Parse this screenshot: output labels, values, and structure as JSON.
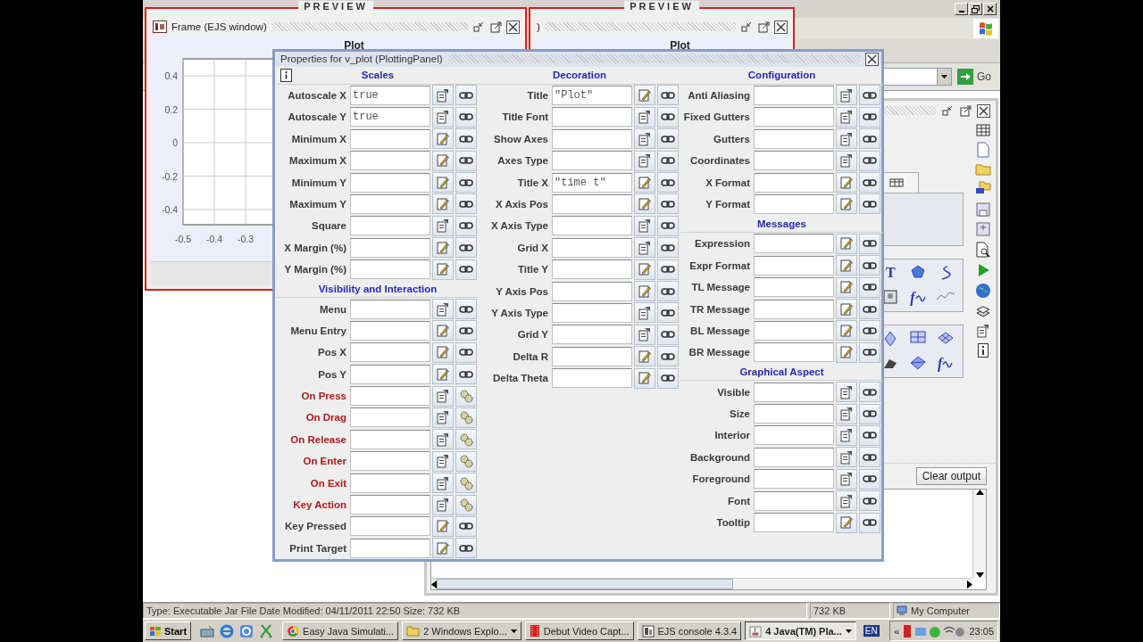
{
  "previews": [
    {
      "label": "PREVIEW",
      "window_title": "Frame (EJS window)",
      "plot_title": "Plot",
      "y_ticks": [
        "0.4",
        "0.2",
        "0",
        "-0.2",
        "-0.4"
      ],
      "x_ticks": [
        "-0.5",
        "-0.4",
        "-0.3"
      ]
    },
    {
      "label": "PREVIEW",
      "window_title": ")",
      "plot_title": "Plot"
    }
  ],
  "properties": {
    "title": "Properties for v_plot (PlottingPanel)",
    "columns": [
      {
        "sections": [
          {
            "title": "Scales",
            "rows": [
              {
                "label": "Autoscale X",
                "value": "true",
                "kind": "list"
              },
              {
                "label": "Autoscale Y",
                "value": "true",
                "kind": "list"
              },
              {
                "label": "Minimum X",
                "kind": "text"
              },
              {
                "label": "Maximum X",
                "kind": "text"
              },
              {
                "label": "Minimum Y",
                "kind": "text"
              },
              {
                "label": "Maximum Y",
                "kind": "text"
              },
              {
                "label": "Square",
                "kind": "list"
              },
              {
                "label": "X Margin (%)",
                "kind": "text"
              },
              {
                "label": "Y Margin (%)",
                "kind": "text"
              }
            ]
          },
          {
            "title": "Visibility and Interaction",
            "rows": [
              {
                "label": "Menu",
                "kind": "list"
              },
              {
                "label": "Menu Entry",
                "kind": "text"
              },
              {
                "label": "Pos X",
                "kind": "text"
              },
              {
                "label": "Pos Y",
                "kind": "text"
              },
              {
                "label": "On Press",
                "kind": "action"
              },
              {
                "label": "On Drag",
                "kind": "action"
              },
              {
                "label": "On Release",
                "kind": "action"
              },
              {
                "label": "On Enter",
                "kind": "action"
              },
              {
                "label": "On Exit",
                "kind": "action"
              },
              {
                "label": "Key Action",
                "kind": "action"
              },
              {
                "label": "Key Pressed",
                "kind": "text"
              },
              {
                "label": "Print Target",
                "kind": "text"
              }
            ]
          }
        ]
      },
      {
        "sections": [
          {
            "title": "Decoration",
            "rows": [
              {
                "label": "Title",
                "value": "\"Plot\"",
                "kind": "text"
              },
              {
                "label": "Title Font",
                "kind": "list"
              },
              {
                "label": "Show Axes",
                "kind": "list"
              },
              {
                "label": "Axes Type",
                "kind": "list"
              },
              {
                "label": "Title X",
                "value": "\"time t\"",
                "kind": "text"
              },
              {
                "label": "X Axis Pos",
                "kind": "text"
              },
              {
                "label": "X Axis Type",
                "kind": "list"
              },
              {
                "label": "Grid X",
                "kind": "list"
              },
              {
                "label": "Title Y",
                "kind": "text"
              },
              {
                "label": "Y Axis Pos",
                "kind": "text"
              },
              {
                "label": "Y Axis Type",
                "kind": "list"
              },
              {
                "label": "Grid Y",
                "kind": "list"
              },
              {
                "label": "Delta R",
                "kind": "text"
              },
              {
                "label": "Delta Theta",
                "kind": "text"
              }
            ]
          }
        ]
      },
      {
        "sections": [
          {
            "title": "Configuration",
            "rows": [
              {
                "label": "Anti Aliasing",
                "kind": "list"
              },
              {
                "label": "Fixed Gutters",
                "kind": "list"
              },
              {
                "label": "Gutters",
                "kind": "list"
              },
              {
                "label": "Coordinates",
                "kind": "list"
              },
              {
                "label": "X Format",
                "kind": "text"
              },
              {
                "label": "Y Format",
                "kind": "text"
              }
            ]
          },
          {
            "title": "Messages",
            "rows": [
              {
                "label": "Expression",
                "kind": "text"
              },
              {
                "label": "Expr Format",
                "kind": "text"
              },
              {
                "label": "TL Message",
                "kind": "text"
              },
              {
                "label": "TR Message",
                "kind": "text"
              },
              {
                "label": "BL Message",
                "kind": "text"
              },
              {
                "label": "BR Message",
                "kind": "text"
              }
            ]
          },
          {
            "title": "Graphical Aspect",
            "rows": [
              {
                "label": "Visible",
                "kind": "list"
              },
              {
                "label": "Size",
                "kind": "list"
              },
              {
                "label": "Interior",
                "kind": "list"
              },
              {
                "label": "Background",
                "kind": "list"
              },
              {
                "label": "Foreground",
                "kind": "list"
              },
              {
                "label": "Font",
                "kind": "list"
              },
              {
                "label": "Tooltip",
                "kind": "text"
              }
            ]
          }
        ]
      }
    ]
  },
  "console": {
    "palettes": [
      [
        {
          "kind": "text",
          "glyph": "T"
        },
        {
          "kind": "polygon"
        },
        {
          "kind": "trace"
        },
        {
          "kind": "image"
        },
        {
          "kind": "function",
          "glyph": "f"
        },
        {
          "kind": "line"
        }
      ],
      [
        {
          "kind": "diamond"
        },
        {
          "kind": "grid"
        },
        {
          "kind": "surface"
        },
        {
          "kind": "model"
        },
        {
          "kind": "polyhedron"
        },
        {
          "kind": "function",
          "glyph": "f"
        }
      ]
    ],
    "clear_button": "Clear output"
  },
  "explorer": {
    "go_button": "Go"
  },
  "status_bar": {
    "info": "Type: Executable Jar File Date Modified: 04/11/2011 22:50 Size: 732 KB",
    "size": "732 KB",
    "zone": "My Computer"
  },
  "taskbar": {
    "start": "Start",
    "tasks": [
      {
        "label": "Easy Java Simulati...",
        "group": false,
        "selected": false
      },
      {
        "label": "2 Windows Explo...",
        "group": true,
        "selected": false
      },
      {
        "label": "Debut Video Capt...",
        "group": false,
        "selected": false
      },
      {
        "label": "EJS console 4.3.4",
        "group": false,
        "selected": false
      },
      {
        "label": "4 Java(TM) Pla...",
        "group": true,
        "selected": true
      }
    ],
    "language": "EN",
    "tray_toggle": "«",
    "clock": "23:05"
  }
}
